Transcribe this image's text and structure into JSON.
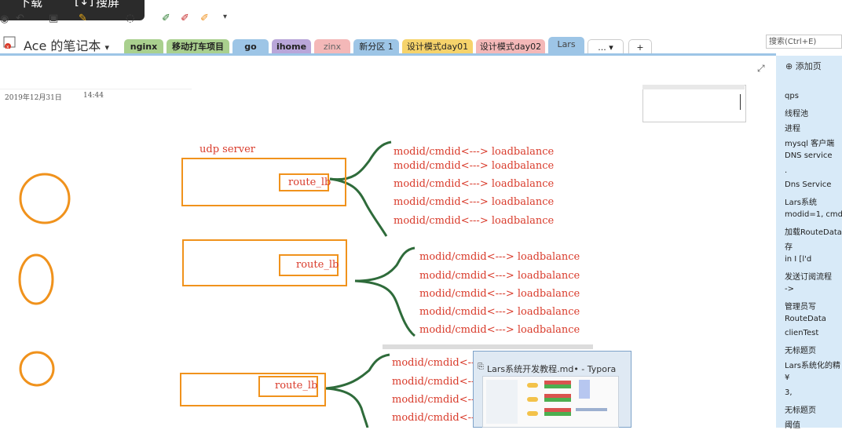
{
  "toolbar": {
    "download_label": "下载",
    "capture_label": "搜屏"
  },
  "notebook": {
    "title": "Ace 的笔记本"
  },
  "tabs": [
    {
      "label": "nginx",
      "color": "#a9d08e"
    },
    {
      "label": "移动打车项目",
      "color": "#a9d08e"
    },
    {
      "label": "go",
      "color": "#9dc5e6"
    },
    {
      "label": "ihome",
      "color": "#b9a6d9"
    },
    {
      "label": "zinx",
      "color": "#f4b8b8"
    },
    {
      "label": "新分区 1",
      "color": "#9dc5e6"
    },
    {
      "label": "设计模式day01",
      "color": "#f6d36b"
    },
    {
      "label": "设计模式day02",
      "color": "#f4b8b8"
    },
    {
      "label": "Lars",
      "color": "#9dc5e6"
    },
    {
      "label": "...",
      "color": "#ffffff"
    },
    {
      "label": "+",
      "color": "#ffffff"
    }
  ],
  "search": {
    "placeholder": "搜索(Ctrl+E)"
  },
  "page": {
    "date": "2019年12月31日",
    "time": "14:44"
  },
  "sidebar": {
    "add_page": "添加页",
    "pages": [
      "qps",
      "线程池",
      "进程",
      "mysql 客户端",
      "DNS service",
      ".",
      "Dns Service",
      "Lars系统",
      "modid=1, cmd",
      "加载RouteData",
      "存",
      "in I [l'd",
      "发送订阅流程",
      "->",
      "管理员写",
      "RouteData",
      "clienTest",
      "无标题页",
      "Lars系统化的精",
      "¥",
      "3,",
      "无标题页",
      "阈值"
    ]
  },
  "drawing": {
    "udp_label": "udp server",
    "route_label": "route_lb",
    "line_text": "modid/cmdid<---> loadbalance",
    "accent": "#f0921c",
    "ink_red": "#d93b2b",
    "ink_green": "#2e6b3a"
  },
  "typora": {
    "title": "Lars系统开发教程.md• - Typora"
  }
}
